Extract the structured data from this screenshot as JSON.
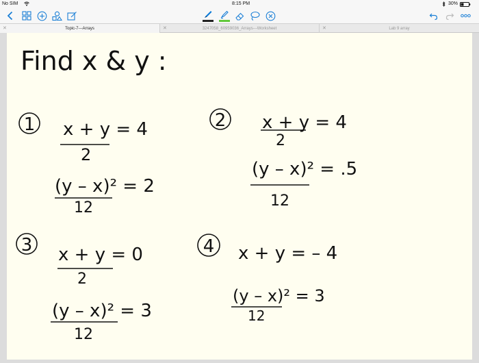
{
  "status": {
    "carrier": "No SIM",
    "time": "8:15 PM",
    "battery": "30%"
  },
  "tabs": [
    {
      "label": "Topic-7---Arrays",
      "active": true
    },
    {
      "label": "3247058_60959036_Arrays---Worksheet",
      "active": false
    },
    {
      "label": "Lab 9 array",
      "active": false
    }
  ],
  "toolbar": {
    "left_icons": [
      "back-icon",
      "grid-icon",
      "add-icon",
      "shapes-icon",
      "edit-icon"
    ],
    "center_icons": [
      "pen-icon",
      "highlighter-icon",
      "eraser-icon",
      "lasso-icon",
      "close-icon"
    ],
    "right_icons": [
      "undo-icon",
      "redo-icon",
      "more-icon"
    ],
    "pen_color": "#0a7bd8",
    "highlighter_color": "#62c93b"
  },
  "note": {
    "heading": "Find x & y :",
    "problems": [
      {
        "number": "1",
        "eq1": "(x+y)/2 = 4",
        "eq2": "(y-x)²/12 = 2"
      },
      {
        "number": "2",
        "eq1": "(x+y)/2 = 4",
        "eq2": "(y-x)²/12 = .5"
      },
      {
        "number": "3",
        "eq1": "(x+y)/2 = 0",
        "eq2": "(y-x)²/12 = 3"
      },
      {
        "number": "4",
        "eq1": "x+y = -4",
        "eq2": "(y-x)²/12 = 3"
      }
    ]
  }
}
